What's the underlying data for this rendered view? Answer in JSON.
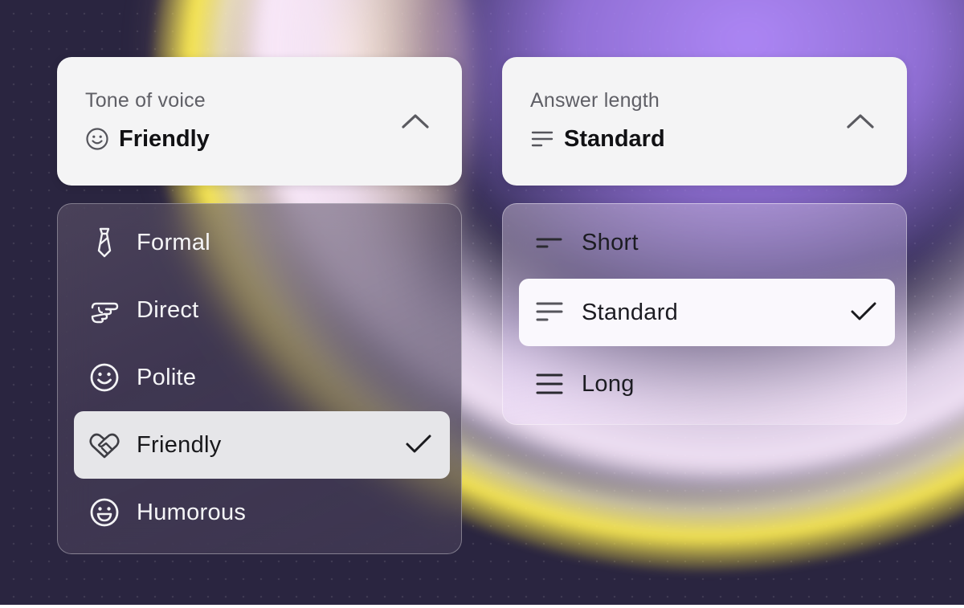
{
  "tone": {
    "label": "Tone of voice",
    "selected_value": "Friendly",
    "selected_icon": "smile-icon",
    "options": [
      {
        "label": "Formal",
        "icon": "tie-icon",
        "selected": false
      },
      {
        "label": "Direct",
        "icon": "pointing-hand-icon",
        "selected": false
      },
      {
        "label": "Polite",
        "icon": "smile-icon",
        "selected": false
      },
      {
        "label": "Friendly",
        "icon": "heart-handshake-icon",
        "selected": true
      },
      {
        "label": "Humorous",
        "icon": "laughing-face-icon",
        "selected": false
      }
    ]
  },
  "length": {
    "label": "Answer length",
    "selected_value": "Standard",
    "selected_icon": "lines-standard-icon",
    "options": [
      {
        "label": "Short",
        "icon": "lines-short-icon",
        "selected": false
      },
      {
        "label": "Standard",
        "icon": "lines-standard-icon",
        "selected": true
      },
      {
        "label": "Long",
        "icon": "lines-long-icon",
        "selected": false
      }
    ]
  },
  "colors": {
    "background": "#2a2540",
    "select_bg": "#f4f4f5",
    "selected_left_bg": "#e6e6e9",
    "selected_right_bg": "#faf8fd",
    "accent_purple": "#b48cff",
    "accent_yellow": "#ffee50"
  }
}
